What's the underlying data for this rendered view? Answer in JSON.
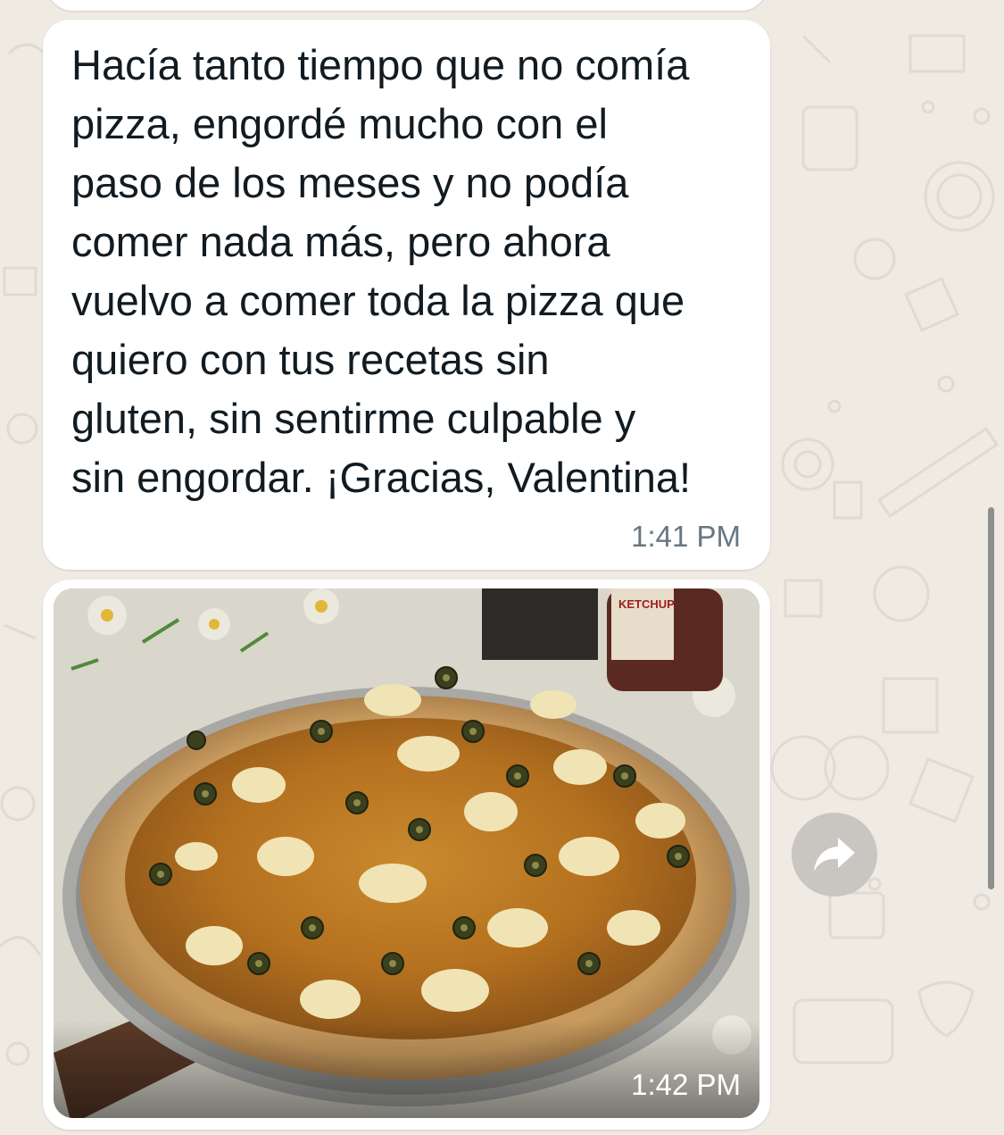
{
  "chat": {
    "messages": [
      {
        "type": "text",
        "text": "Hacía tanto tiempo que no comía\npizza, engordé mucho con el\npaso de los meses y no podía\ncomer nada más, pero ahora\nvuelvo a comer toda la pizza que\nquiero con tus recetas sin\ngluten, sin sentirme culpable y\nsin engordar. ¡Gracias, Valentina!",
        "time": "1:41 PM"
      },
      {
        "type": "image",
        "image_description": "homemade pizza with olives and cheese on a metal tray, ketchup bottle in background",
        "bottle_label": "KETCHUP",
        "time": "1:42 PM"
      }
    ],
    "actions": {
      "forward_icon": "forward-arrow-icon"
    }
  },
  "colors": {
    "wallpaper": "#efeae2",
    "bubble": "#ffffff",
    "text": "#111b21",
    "timestamp": "#667781",
    "forward_button": "#c9c6c1"
  }
}
